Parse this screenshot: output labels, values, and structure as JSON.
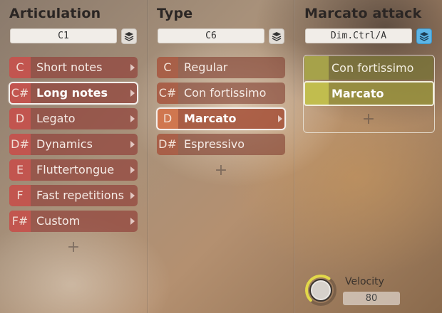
{
  "columns": [
    {
      "title": "Articulation",
      "key_field": "C1",
      "layer_active": false,
      "items": [
        {
          "key": "C",
          "label": "Short notes",
          "selected": false,
          "has_arrow": true
        },
        {
          "key": "C#",
          "label": "Long notes",
          "selected": true,
          "has_arrow": true
        },
        {
          "key": "D",
          "label": "Legato",
          "selected": false,
          "has_arrow": true
        },
        {
          "key": "D#",
          "label": "Dynamics",
          "selected": false,
          "has_arrow": true
        },
        {
          "key": "E",
          "label": "Fluttertongue",
          "selected": false,
          "has_arrow": true
        },
        {
          "key": "F",
          "label": "Fast repetitions",
          "selected": false,
          "has_arrow": true
        },
        {
          "key": "F#",
          "label": "Custom",
          "selected": false,
          "has_arrow": true
        }
      ],
      "add_symbol": "+"
    },
    {
      "title": "Type",
      "key_field": "C6",
      "layer_active": false,
      "items": [
        {
          "key": "C",
          "label": "Regular",
          "selected": false,
          "has_arrow": false
        },
        {
          "key": "C#",
          "label": "Con fortissimo",
          "selected": false,
          "has_arrow": false
        },
        {
          "key": "D",
          "label": "Marcato",
          "selected": true,
          "has_arrow": true
        },
        {
          "key": "D#",
          "label": "Espressivo",
          "selected": false,
          "has_arrow": false
        }
      ],
      "add_symbol": "+"
    },
    {
      "title": "Marcato attack",
      "key_field": "Dim.Ctrl/A",
      "layer_active": true,
      "items": [
        {
          "label": "Con fortissimo",
          "selected": false
        },
        {
          "label": "Marcato",
          "selected": true
        }
      ],
      "add_symbol": "+"
    }
  ],
  "velocity": {
    "label": "Velocity",
    "value": "80",
    "level": 0.63
  },
  "colors": {
    "layer_active": "#5db5e6",
    "knob_ring": "#e2d84a"
  }
}
